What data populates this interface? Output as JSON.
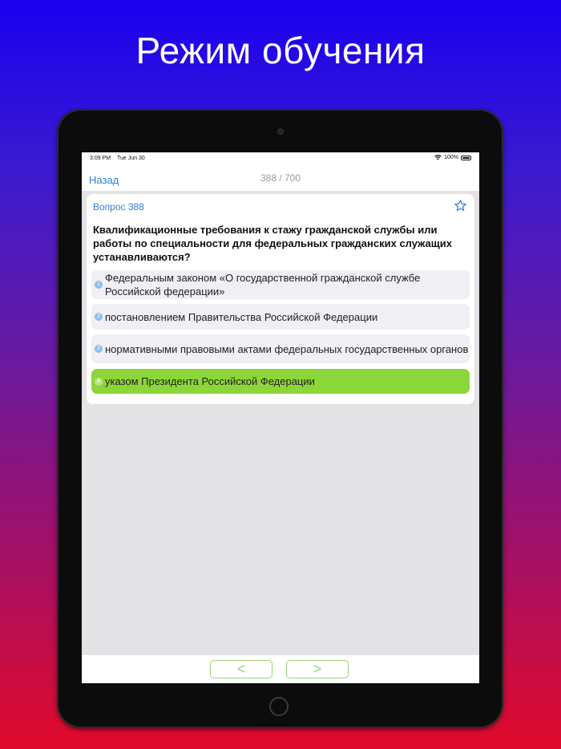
{
  "headline": "Режим обучения",
  "status_bar": {
    "time": "3:09 PM",
    "date": "Tue Jun 30",
    "battery": "100%"
  },
  "nav": {
    "back_label": "Назад",
    "counter": "388 / 700"
  },
  "question": {
    "number_label": "Вопрос 388",
    "text": "Квалификационные требования к стажу гражданской службы или работы по специальности для федеральных гражданских служащих устанавливаются?",
    "answers": [
      {
        "num": "1",
        "text": "Федеральным законом «О государственной гражданской службе Российской федерации»",
        "correct": false
      },
      {
        "num": "2",
        "text": "постановлением Правительства Российской Федерации",
        "correct": false
      },
      {
        "num": "3",
        "text": "нормативными правовыми актами федеральных государственных органов",
        "correct": false
      },
      {
        "num": "4",
        "text": "указом Президента Российской Федерации",
        "correct": true
      }
    ]
  },
  "bottom": {
    "prev_glyph": "<",
    "next_glyph": ">"
  },
  "colors": {
    "accent": "#2f7fd8",
    "correct": "#8dd63a",
    "nav_border": "#9bd47a"
  },
  "icons": {
    "favorite": "star-outline-icon",
    "wifi": "wifi-icon",
    "battery": "battery-icon"
  }
}
